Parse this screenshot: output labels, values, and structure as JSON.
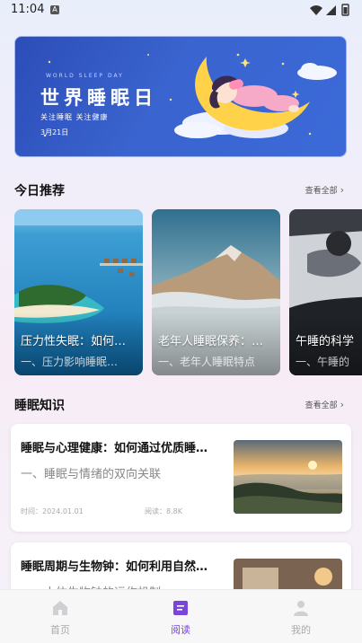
{
  "status_bar": {
    "time": "11:04",
    "badge": "A"
  },
  "banner": {
    "eyebrow": "WORLD SLEEP DAY",
    "title": "世界睡眠日",
    "subtitle": "关注睡眠  关注健康",
    "date": "3月21日"
  },
  "recommend": {
    "title": "今日推荐",
    "more": "查看全部",
    "cards": [
      {
        "title": "压力性失眠：如何…",
        "subtitle": "一、压力影响睡眠…"
      },
      {
        "title": "老年人睡眠保养：…",
        "subtitle": "一、老年人睡眠特点"
      },
      {
        "title": "午睡的科学",
        "subtitle": "一、午睡的"
      }
    ]
  },
  "knowledge": {
    "title": "睡眠知识",
    "more": "查看全部",
    "articles": [
      {
        "title": "睡眠与心理健康：如何通过优质睡…",
        "subtitle": "一、睡眠与情绪的双向关联",
        "time_label": "时间：",
        "time": "2024.01.01",
        "reads_label": "阅读：",
        "reads": "8.8K"
      },
      {
        "title": "睡眠周期与生物钟：如何利用自然…",
        "subtitle": "一、人体生物钟的运作机制"
      }
    ]
  },
  "tabbar": {
    "accent": "#7a45d8",
    "tabs": [
      {
        "label": "首页",
        "icon": "home-icon",
        "active": false
      },
      {
        "label": "阅读",
        "icon": "book-icon",
        "active": true
      },
      {
        "label": "我的",
        "icon": "user-icon",
        "active": false
      }
    ]
  }
}
